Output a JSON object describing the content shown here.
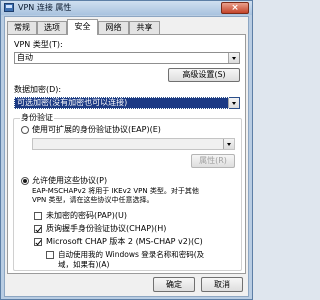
{
  "window": {
    "title": "VPN 连接 属性",
    "close_label": "×"
  },
  "tabs": [
    {
      "label": "常规"
    },
    {
      "label": "选项"
    },
    {
      "label": "安全"
    },
    {
      "label": "网络"
    },
    {
      "label": "共享"
    }
  ],
  "vpn_type": {
    "label": "VPN 类型(T):",
    "value": "自动"
  },
  "advanced_settings_label": "高级设置(S)",
  "data_encryption": {
    "label": "数据加密(D):",
    "value": "可选加密(没有加密也可以连接)"
  },
  "auth_group": {
    "title": "身份验证",
    "eap_radio_label": "使用可扩展的身份验证协议(EAP)(E)",
    "eap_combo_value": "",
    "properties_label": "属性(R)",
    "allow_protocols_label": "允许使用这些协议(P)",
    "description_line1": "EAP-MSCHAPv2 将用于 IKEv2 VPN 类型。对于其他",
    "description_line2": "VPN 类型，请在这些协议中任意选择。",
    "unencrypted_pap_label": "未加密的密码(PAP)(U)",
    "chap_label": "质询握手身份验证协议(CHAP)(H)",
    "mschap_label": "Microsoft CHAP 版本 2 (MS-CHAP v2)(C)",
    "auto_windows_line1": "自动使用我的 Windows 登录名称和密码(及",
    "auto_windows_line2": "域，如果有)(A)"
  },
  "buttons": {
    "ok": "确定",
    "cancel": "取消"
  }
}
